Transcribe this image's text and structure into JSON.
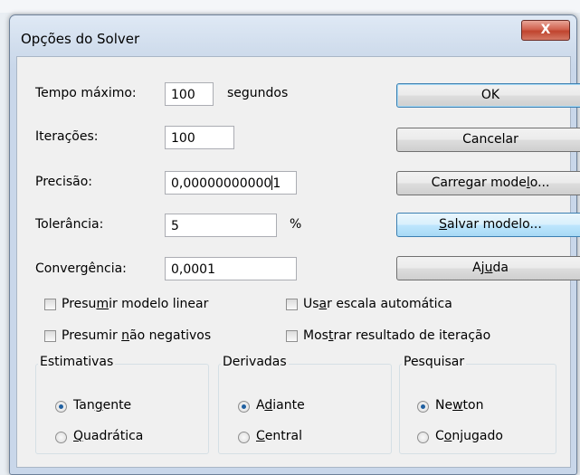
{
  "window": {
    "title": "Opções do Solver",
    "close_label": "X"
  },
  "fields": {
    "tempo": {
      "label": "Tempo máximo:",
      "value": "100",
      "unit": "segundos"
    },
    "iteracoes": {
      "label": "Iterações:",
      "value": "100"
    },
    "precisao": {
      "label": "Precisão:",
      "value_before_cursor": "0,00000000000",
      "value_after_cursor": "1"
    },
    "tolerancia": {
      "label": "Tolerância:",
      "value": "5",
      "unit": "%"
    },
    "convergencia": {
      "label": "Convergência:",
      "value": "0,0001"
    }
  },
  "buttons": {
    "ok": "OK",
    "cancelar": "Cancelar",
    "carregar": {
      "before": "Carregar mode",
      "mnemonic": "l",
      "after": "o..."
    },
    "salvar": {
      "before": "",
      "mnemonic": "S",
      "after": "alvar modelo..."
    },
    "ajuda": {
      "before": "Aj",
      "mnemonic": "u",
      "after": "da"
    }
  },
  "checkboxes": {
    "linear": {
      "before": "Presu",
      "mnemonic": "m",
      "after": "ir modelo linear",
      "checked": false
    },
    "negativos": {
      "before": "Presumir ",
      "mnemonic": "n",
      "after": "ão negativos",
      "checked": false
    },
    "escala": {
      "before": "Us",
      "mnemonic": "a",
      "after": "r escala automática",
      "checked": false
    },
    "resultado": {
      "before": "Mos",
      "mnemonic": "t",
      "after": "rar resultado de iteração",
      "checked": false
    }
  },
  "groups": {
    "estimativas": {
      "title": "Estimativas",
      "opt1": {
        "before": "Tan",
        "mnemonic": "g",
        "after": "ente",
        "selected": true
      },
      "opt2": {
        "before": "",
        "mnemonic": "Q",
        "after": "uadrática",
        "selected": false
      }
    },
    "derivadas": {
      "title": "Derivadas",
      "opt1": {
        "before": "A",
        "mnemonic": "d",
        "after": "iante",
        "selected": true
      },
      "opt2": {
        "before": "",
        "mnemonic": "C",
        "after": "entral",
        "selected": false
      }
    },
    "pesquisar": {
      "title": "Pesquisar",
      "opt1": {
        "before": "Ne",
        "mnemonic": "w",
        "after": "ton",
        "selected": true
      },
      "opt2": {
        "before": "C",
        "mnemonic": "o",
        "after": "njugado",
        "selected": false
      }
    }
  }
}
